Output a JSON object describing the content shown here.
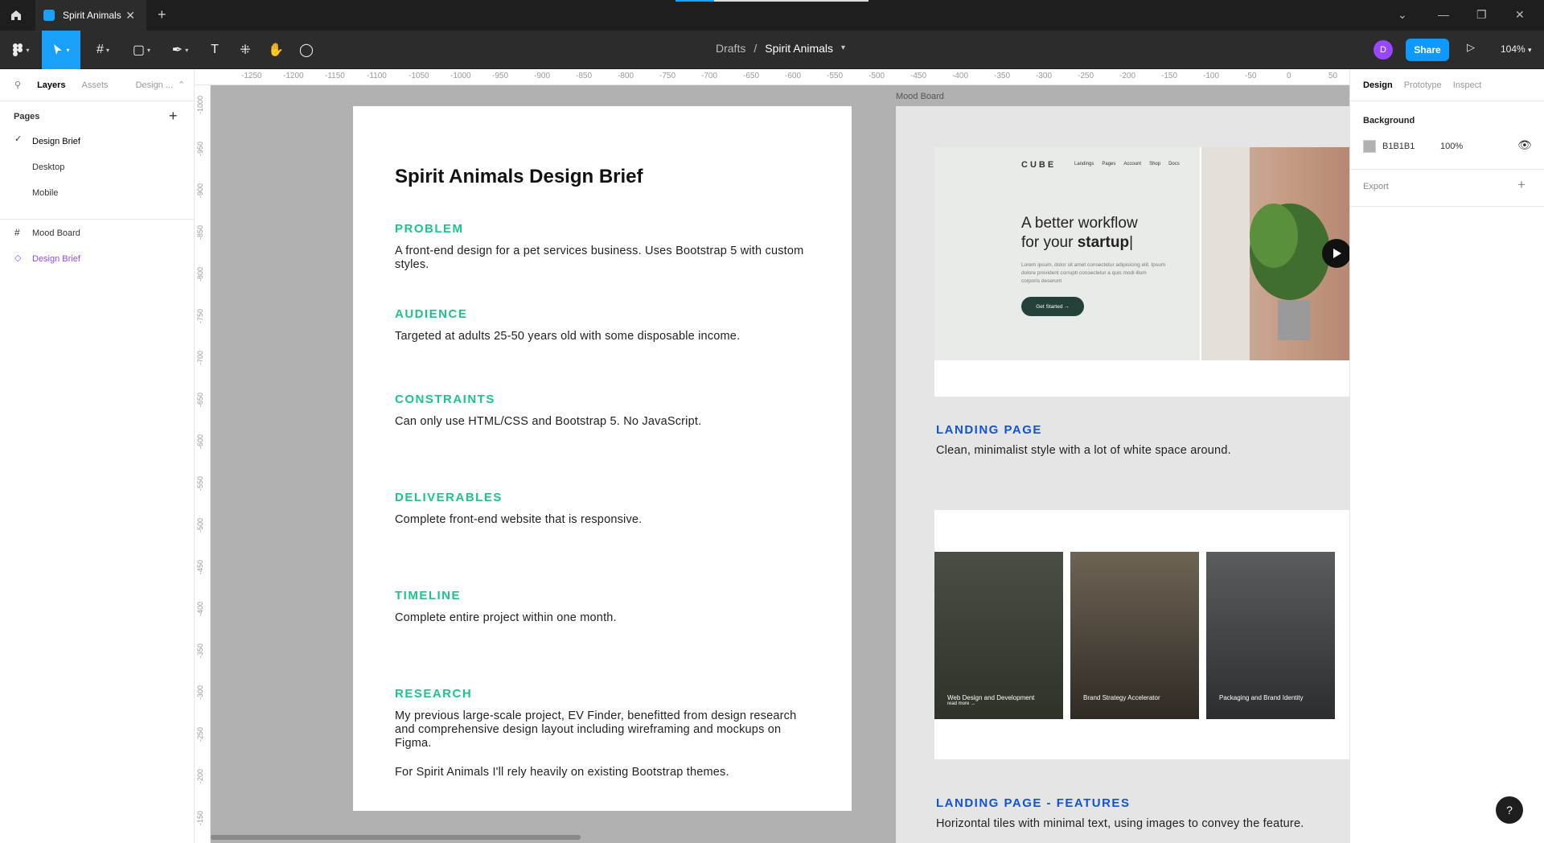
{
  "tab": {
    "title": "Spirit Animals"
  },
  "toolbar": {
    "breadcrumb_parent": "Drafts",
    "breadcrumb_sep": "/",
    "file_name": "Spirit Animals",
    "share_label": "Share",
    "avatar_initial": "D",
    "zoom": "104%"
  },
  "left_panel": {
    "tabs": [
      "Layers",
      "Assets",
      "Design ..."
    ],
    "pages_title": "Pages",
    "pages": [
      "Design Brief",
      "Desktop",
      "Mobile"
    ],
    "layers": [
      "Mood Board",
      "Design Brief"
    ]
  },
  "ruler": {
    "h": [
      "-1250",
      "-1200",
      "-1150",
      "-1100",
      "-1050",
      "-1000",
      "-950",
      "-900",
      "-850",
      "-800",
      "-750",
      "-700",
      "-650",
      "-600",
      "-550",
      "-500",
      "-450",
      "-400",
      "-350",
      "-300",
      "-250",
      "-200",
      "-150",
      "-100",
      "-50",
      "0",
      "50"
    ],
    "v": [
      "-1000",
      "-950",
      "-900",
      "-850",
      "-800",
      "-750",
      "-700",
      "-650",
      "-600",
      "-550",
      "-500",
      "-450",
      "-400",
      "-350",
      "-300",
      "-250",
      "-200",
      "-150"
    ]
  },
  "brief": {
    "title": "Spirit Animals Design Brief",
    "sections": [
      {
        "heading": "PROBLEM",
        "text": "A front-end design for a pet services business. Uses Bootstrap 5 with custom styles."
      },
      {
        "heading": "AUDIENCE",
        "text": "Targeted at adults 25-50 years old with some disposable income."
      },
      {
        "heading": "CONSTRAINTS",
        "text": "Can only use HTML/CSS and Bootstrap 5. No JavaScript."
      },
      {
        "heading": "DELIVERABLES",
        "text": "Complete front-end website that is responsive."
      },
      {
        "heading": "TIMELINE",
        "text": "Complete entire project within one month."
      },
      {
        "heading": "RESEARCH",
        "text": "My previous large-scale project, EV Finder, benefitted from design research and comprehensive design layout including wireframing and mockups on Figma."
      }
    ],
    "research_extra": "For Spirit Animals I'll rely heavily on existing Bootstrap themes."
  },
  "mood": {
    "label": "Mood Board",
    "cube": {
      "logo": "CUBE",
      "nav": [
        "Landings",
        "Pages",
        "Account",
        "Shop",
        "Docs"
      ],
      "headline1": "A better workflow",
      "headline2a": "for your ",
      "headline2b": "startup",
      "lorem": "Lorem ipsum, dolor sit amet consectetur adipisicing elit. Ipsum dolore provident corrupti consectetur a quis modi illum corporis deserunt",
      "cta": "Get Started  →"
    },
    "landing_heading": "LANDING PAGE",
    "landing_text": "Clean, minimalist style with a lot of white space around.",
    "tiles": [
      "Web Design and Development",
      "Brand Strategy Accelerator",
      "Packaging and Brand Identity"
    ],
    "tile_link": "read more →",
    "features_heading": "LANDING PAGE - FEATURES",
    "features_text": "Horizontal tiles with minimal text, using images to convey the feature."
  },
  "right_panel": {
    "tabs": [
      "Design",
      "Prototype",
      "Inspect"
    ],
    "background_title": "Background",
    "bg_hex": "B1B1B1",
    "bg_opacity": "100%",
    "bg_color": "#b1b1b1",
    "export_title": "Export"
  },
  "help": "?"
}
